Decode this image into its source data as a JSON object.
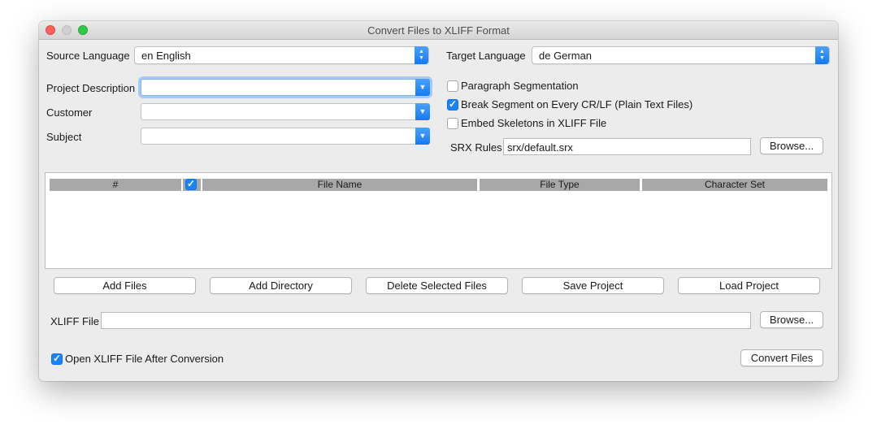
{
  "window": {
    "title": "Convert Files to XLIFF Format"
  },
  "source": {
    "label": "Source Language",
    "value": "en English"
  },
  "target": {
    "label": "Target Language",
    "value": "de German"
  },
  "project": {
    "label": "Project Description",
    "value": ""
  },
  "customer": {
    "label": "Customer",
    "value": ""
  },
  "subject": {
    "label": "Subject",
    "value": ""
  },
  "options": {
    "paragraph_segmentation": {
      "label": "Paragraph Segmentation",
      "checked": false
    },
    "break_segment": {
      "label": "Break Segment on Every CR/LF (Plain Text Files)",
      "checked": true
    },
    "embed_skeletons": {
      "label": "Embed Skeletons in XLIFF File",
      "checked": false
    }
  },
  "srx": {
    "label": "SRX Rules",
    "value": "srx/default.srx",
    "browse": "Browse..."
  },
  "table": {
    "columns": [
      "#",
      "File Name",
      "File Type",
      "Character Set"
    ],
    "rows": []
  },
  "actions": {
    "add_files": "Add Files",
    "add_directory": "Add Directory",
    "delete_selected": "Delete Selected Files",
    "save_project": "Save Project",
    "load_project": "Load Project"
  },
  "xliff": {
    "label": "XLIFF File",
    "value": "",
    "browse": "Browse..."
  },
  "open_after": {
    "label": "Open XLIFF File After Conversion",
    "checked": true
  },
  "convert": {
    "label": "Convert Files"
  },
  "colors": {
    "accent": "#1a82fb",
    "header": "#a8a8a8",
    "window": "#ececec"
  }
}
